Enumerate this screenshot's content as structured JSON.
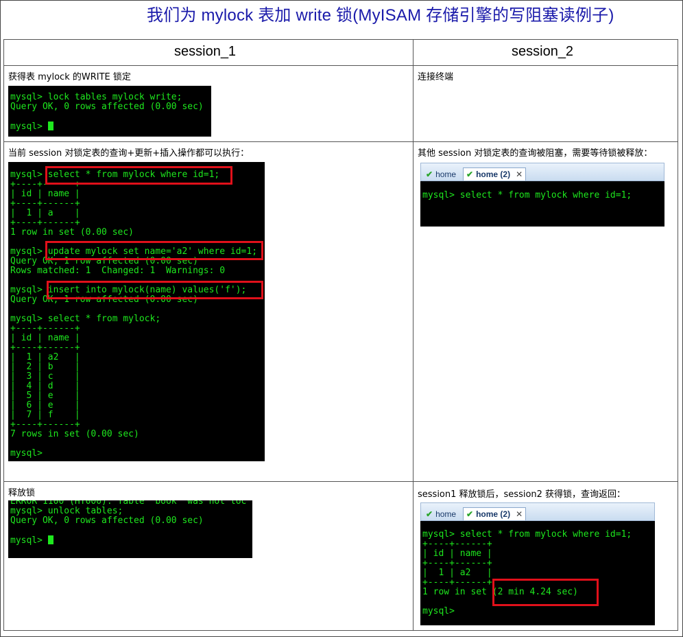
{
  "title": "我们为 mylock 表加 write 锁(MyISAM 存储引擎的写阻塞读例子)",
  "headers": {
    "s1": "session_1",
    "s2": "session_2"
  },
  "rows": [
    {
      "c1": "获得表 mylock 的WRITE 锁定",
      "c2": "连接终端"
    },
    {
      "c1": "当前 session 对锁定表的查询+更新+插入操作都可以执行：",
      "c2": "其他 session 对锁定表的查询被阻塞，需要等待锁被释放："
    },
    {
      "c1": "释放锁",
      "c2": "session1 释放锁后，session2 获得锁，查询返回："
    }
  ],
  "tabs": {
    "home": "home",
    "home2": "home (2)"
  },
  "term1": "mysql> lock tables mylock write;\nQuery OK, 0 rows affected (0.00 sec)\n\nmysql> ",
  "term2": "mysql> select * from mylock where id=1;\n+----+------+\n| id | name |\n+----+------+\n|  1 | a    |\n+----+------+\n1 row in set (0.00 sec)\n\nmysql> update mylock set name='a2' where id=1;\nQuery OK, 1 row affected (0.00 sec)\nRows matched: 1  Changed: 1  Warnings: 0\n\nmysql> insert into mylock(name) values('f');\nQuery OK, 1 row affected (0.00 sec)\n\nmysql> select * from mylock;\n+----+------+\n| id | name |\n+----+------+\n|  1 | a2   |\n|  2 | b    |\n|  3 | c    |\n|  4 | d    |\n|  5 | e    |\n|  6 | e    |\n|  7 | f    |\n+----+------+\n7 rows in set (0.00 sec)\n\nmysql>",
  "term3": "mysql> select * from mylock where id=1;",
  "term4": "ERROR 1100 (HY000): Table 'book' was not loc\nmysql> unlock tables;\nQuery OK, 0 rows affected (0.00 sec)\n\nmysql> ",
  "term5": "mysql> select * from mylock where id=1;\n+----+------+\n| id | name |\n+----+------+\n|  1 | a2   |\n+----+------+\n1 row in set (2 min 4.24 sec)\n\nmysql>"
}
